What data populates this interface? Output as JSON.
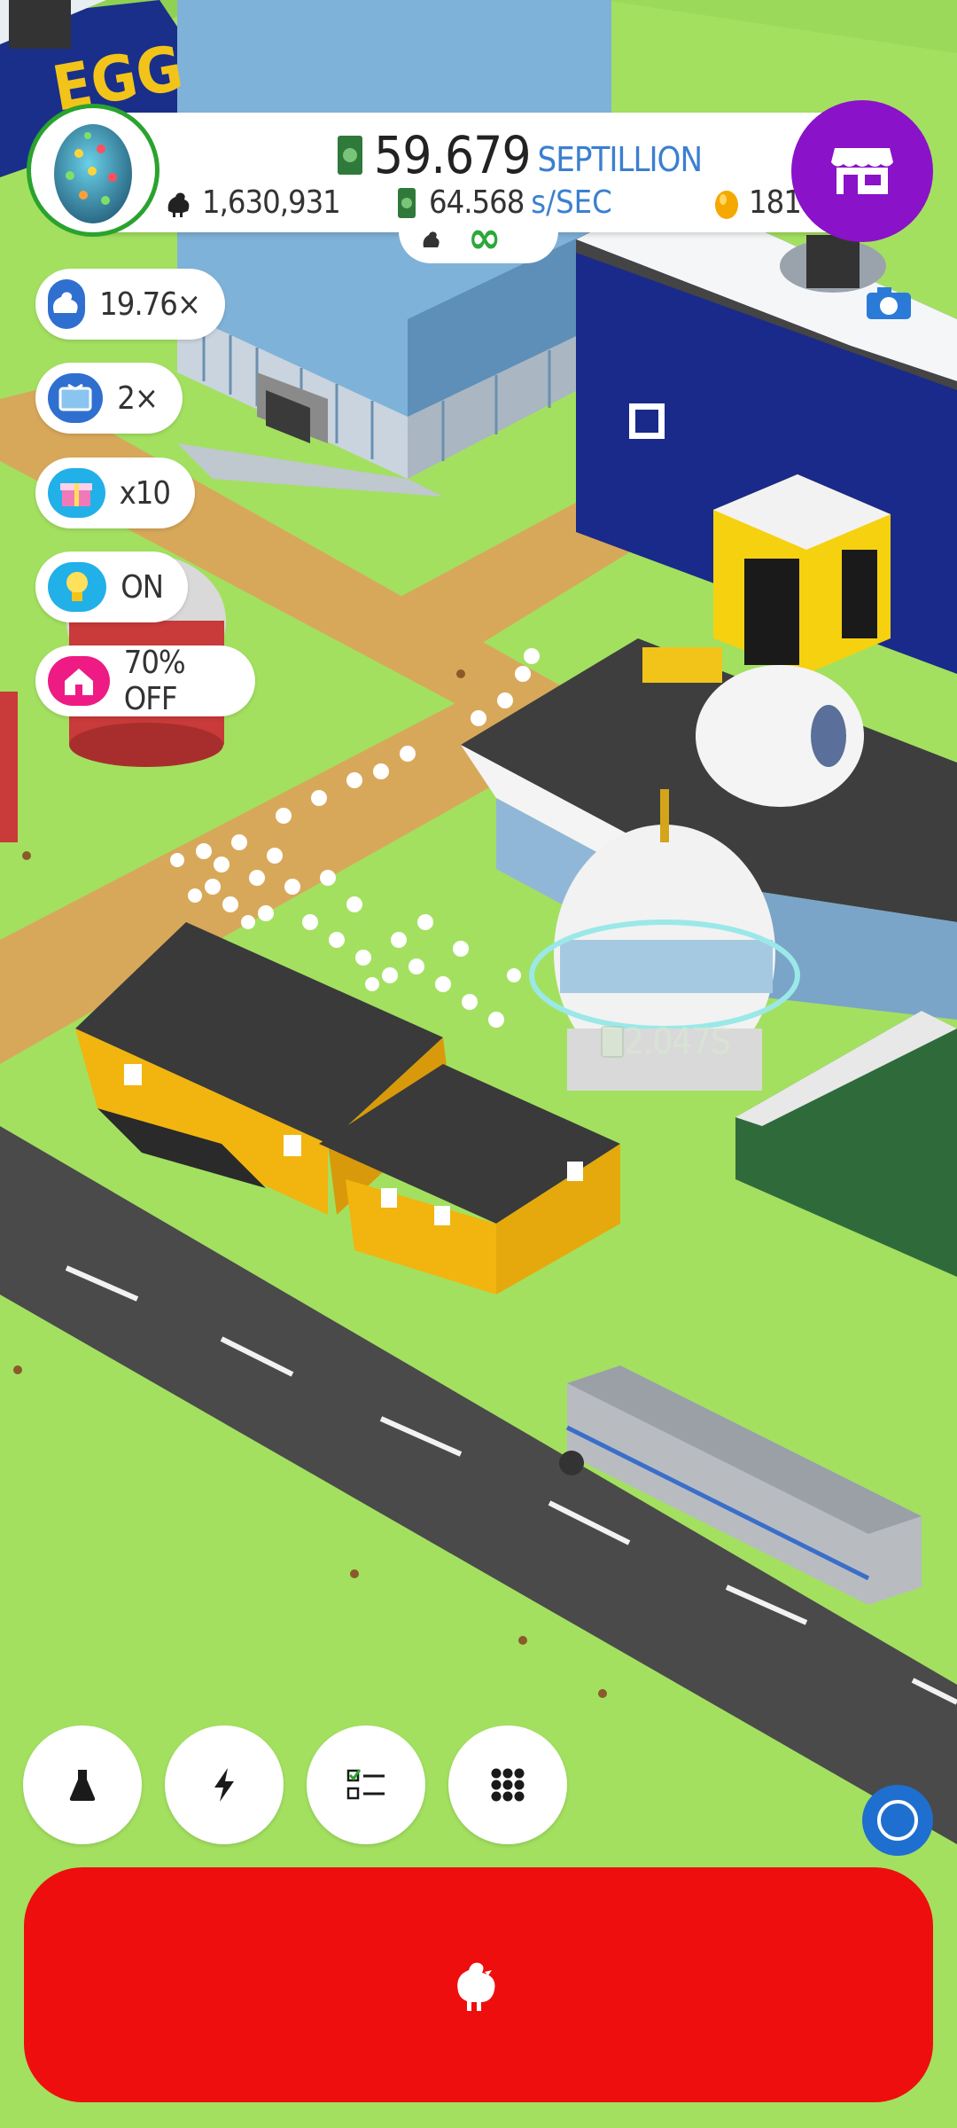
{
  "hud": {
    "money_value": "59.679",
    "money_unit": "SEPTILLION",
    "chicken_count": "1,630,931",
    "earn_rate": "64.568",
    "earn_rate_unit": "s/SEC",
    "golden_eggs": "181",
    "infinity_symbol": "∞"
  },
  "boosts": [
    {
      "icon": "chicken-multiplier-icon",
      "label": "19.76×",
      "color": "#2f6fd0"
    },
    {
      "icon": "video-ad-icon",
      "label": "2×",
      "color": "#2f6fd0"
    },
    {
      "icon": "gift-box-icon",
      "label": "x10",
      "color": "#22b0e8"
    },
    {
      "icon": "lightbulb-icon",
      "label": "ON",
      "color": "#22b0e8"
    },
    {
      "icon": "house-discount-icon",
      "label": "70% OFF",
      "color": "#ef1b84"
    }
  ],
  "scene": {
    "building_sign": "EGG",
    "silo_income_label": "2.047S"
  },
  "bottom_nav": [
    {
      "icon": "flask-icon"
    },
    {
      "icon": "lightning-icon"
    },
    {
      "icon": "checklist-icon"
    },
    {
      "icon": "grid-menu-icon"
    }
  ],
  "colors": {
    "hatch_button": "#ee0e0e",
    "shop_button": "#8a12c8",
    "grass": "#a3e060",
    "accent_blue": "#3b7fd0"
  }
}
